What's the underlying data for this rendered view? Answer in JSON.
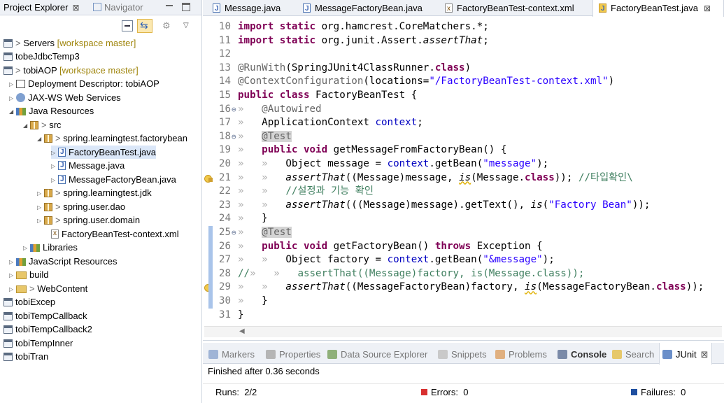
{
  "left_panel": {
    "tab_active": "Project Explorer",
    "tab_inactive": "Navigator",
    "close_glyph": "⊠",
    "tree": [
      {
        "text": "Servers",
        "decor": "[workspace master]",
        "icon": "project-icon"
      },
      {
        "text": "tobeJdbcTemp3",
        "icon": "project-icon"
      },
      {
        "text": "tobiAOP",
        "decor": "[workspace master]",
        "icon": "project-icon"
      },
      {
        "text": "Deployment Descriptor: tobiAOP",
        "icon": "deployment-descriptor-icon"
      },
      {
        "text": "JAX-WS Web Services",
        "icon": "web-services-icon"
      },
      {
        "text": "Java Resources",
        "icon": "java-resources-icon"
      },
      {
        "text": "src",
        "icon": "source-folder-icon"
      },
      {
        "text": "spring.learningtest.factorybean",
        "icon": "package-icon"
      },
      {
        "text": "FactoryBeanTest.java",
        "icon": "java-file-icon"
      },
      {
        "text": "Message.java",
        "icon": "java-file-icon"
      },
      {
        "text": "MessageFactoryBean.java",
        "icon": "java-file-icon"
      },
      {
        "text": "spring.learningtest.jdk",
        "icon": "package-icon"
      },
      {
        "text": "spring.user.dao",
        "icon": "package-icon"
      },
      {
        "text": "spring.user.domain",
        "icon": "package-icon"
      },
      {
        "text": "FactoryBeanTest-context.xml",
        "icon": "xml-file-icon"
      },
      {
        "text": "Libraries",
        "icon": "libraries-icon"
      },
      {
        "text": "JavaScript Resources",
        "icon": "libraries-icon"
      },
      {
        "text": "build",
        "icon": "folder-icon"
      },
      {
        "text": "WebContent",
        "icon": "folder-icon"
      },
      {
        "text": "tobiExcep",
        "icon": "project-icon"
      },
      {
        "text": "tobiTempCallback",
        "icon": "project-icon"
      },
      {
        "text": "tobiTempCallback2",
        "icon": "project-icon"
      },
      {
        "text": "tobiTempInner",
        "icon": "project-icon"
      },
      {
        "text": "tobiTran",
        "icon": "project-icon"
      }
    ]
  },
  "editor": {
    "tabs": [
      "Message.java",
      "MessageFactoryBean.java",
      "FactoryBeanTest-context.xml",
      "FactoryBeanTest.java"
    ],
    "active_tab": "FactoryBeanTest.java",
    "code": {
      "l10": {
        "n": "10",
        "a": "import",
        "b": " ",
        "c": "static",
        "d": " org.hamcrest.CoreMatchers.*;"
      },
      "l11": {
        "n": "11",
        "a": "import",
        "b": " ",
        "c": "static",
        "d": " org.junit.Assert.",
        "e": "assertThat",
        "f": ";"
      },
      "l12": {
        "n": "12"
      },
      "l13": {
        "n": "13",
        "a": "@RunWith",
        "b": "(SpringJUnit4ClassRunner.",
        "c": "class",
        "d": ")"
      },
      "l14": {
        "n": "14",
        "a": "@ContextConfiguration",
        "b": "(locations=",
        "c": "\"/FactoryBeanTest-context.xml\"",
        "d": ")"
      },
      "l15": {
        "n": "15",
        "a": "public",
        "b": " ",
        "c": "class",
        "d": " FactoryBeanTest {"
      },
      "l16": {
        "n": "16",
        "a": "@Autowired"
      },
      "l17": {
        "n": "17",
        "a": "ApplicationContext ",
        "b": "context",
        "c": ";"
      },
      "l18": {
        "n": "18",
        "a": "@Test"
      },
      "l19": {
        "n": "19",
        "a": "public",
        "b": " ",
        "c": "void",
        "d": " getMessageFromFactoryBean() {"
      },
      "l20": {
        "n": "20",
        "a": "Object ",
        "b": "message",
        "c": " = ",
        "d": "context",
        "e": ".getBean(",
        "f": "\"message\"",
        "g": ");"
      },
      "l21": {
        "n": "21",
        "a": "assertThat",
        "b": "((Message)",
        "c": "message",
        "d": ", ",
        "e": "is",
        "f": "(Message.",
        "g": "class",
        "h": ")); ",
        "i": "//타입확인\\"
      },
      "l22": {
        "n": "22",
        "a": "//설정과 기능 확인"
      },
      "l23": {
        "n": "23",
        "a": "assertThat",
        "b": "(((Message)",
        "c": "message",
        "d": ").getText(), ",
        "e": "is",
        "f": "(",
        "g": "\"Factory Bean\"",
        "h": "));"
      },
      "l24": {
        "n": "24",
        "a": "}"
      },
      "l25": {
        "n": "25",
        "a": "@Test"
      },
      "l26": {
        "n": "26",
        "a": "public",
        "b": " ",
        "c": "void",
        "d": " getFactoryBean() ",
        "e": "throws",
        "f": " Exception {"
      },
      "l27": {
        "n": "27",
        "a": "Object ",
        "b": "factory",
        "c": " = ",
        "d": "context",
        "e": ".getBean(",
        "f": "\"&message\"",
        "g": ");"
      },
      "l28": {
        "n": "28",
        "a": "//",
        "b": "assertThat((Message)factory, is(Message.class));"
      },
      "l29": {
        "n": "29",
        "a": "assertThat",
        "b": "((MessageFactoryBean)",
        "c": "factory",
        "d": ", ",
        "e": "is",
        "f": "(MessageFactoryBean.",
        "g": "class",
        "h": "));"
      },
      "l30": {
        "n": "30",
        "a": "}"
      },
      "l31": {
        "n": "31",
        "a": "}"
      }
    }
  },
  "bottom_panel": {
    "tabs": [
      "Markers",
      "Properties",
      "Data Source Explorer",
      "Snippets",
      "Problems",
      "Console",
      "Search",
      "JUnit"
    ],
    "active_tab": "JUnit",
    "status": "Finished after 0.36 seconds",
    "runs_label": "Runs:",
    "runs_value": "2/2",
    "errors_label": "Errors:",
    "errors_value": "0",
    "failures_label": "Failures:",
    "failures_value": "0",
    "colors": {
      "error_red": "#d83030",
      "failure_blue": "#1f4fa0"
    }
  }
}
